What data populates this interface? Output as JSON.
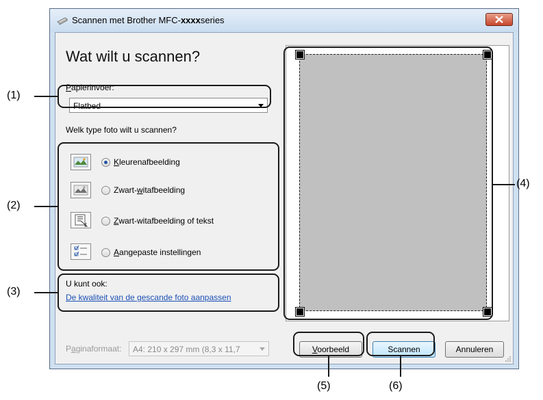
{
  "window": {
    "title": "Scannen met Brother MFC-xxxxseries",
    "title_prefix": "Scannen met Brother MFC-",
    "title_bold": "xxxx",
    "title_suffix": "series"
  },
  "main": {
    "heading": "Wat wilt u scannen?",
    "paper_feed_label": "Papierinvoer:",
    "paper_feed_value": "Flatbed",
    "photo_type_question": "Welk type foto wilt u scannen?",
    "photo_types": [
      {
        "label": "Kleurenafbeelding",
        "selected": true,
        "icon": "color-picture-icon"
      },
      {
        "label": "Zwart-witafbeelding",
        "selected": false,
        "icon": "grayscale-picture-icon"
      },
      {
        "label": "Zwart-witafbeelding of tekst",
        "selected": false,
        "icon": "text-picture-icon"
      },
      {
        "label": "Aangepaste instellingen",
        "selected": false,
        "icon": "custom-settings-icon"
      }
    ],
    "also_label": "U kunt ook:",
    "adjust_quality_link": "De kwaliteit van de gescande foto aanpassen"
  },
  "footer": {
    "page_size_label": "Paginaformaat:",
    "page_size_value": "A4: 210 x 297 mm (8,3 x 11,7",
    "preview_button": "Voorbeeld",
    "scan_button": "Scannen",
    "cancel_button": "Annuleren"
  },
  "callouts": [
    "(1)",
    "(2)",
    "(3)",
    "(4)",
    "(5)",
    "(6)"
  ],
  "colors": {
    "link": "#1a4fb5",
    "radio_selected": "#2455a4",
    "scan_area": "#c0c0c0",
    "close_button": "#c8452c"
  }
}
